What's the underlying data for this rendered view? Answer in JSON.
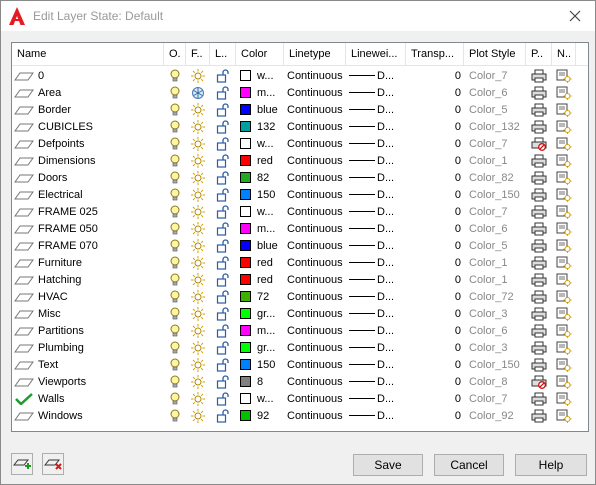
{
  "title": "Edit Layer State: Default",
  "columns": {
    "name": "Name",
    "on": "O.",
    "freeze": "F..",
    "lock": "L..",
    "color": "Color",
    "linetype": "Linetype",
    "lineweight": "Linewei...",
    "transparency": "Transp...",
    "plot_style": "Plot Style",
    "plot": "P..",
    "new_vp_freeze": "N.."
  },
  "layers": [
    {
      "name": "0",
      "color_name": "w...",
      "color": "#ffffff",
      "linetype": "Continuous",
      "lineweight": "D...",
      "transparency": "0",
      "plot_style": "Color_7",
      "icon": "layer-icon",
      "frozen": false,
      "plot": true
    },
    {
      "name": "Area",
      "color_name": "m...",
      "color": "#ff00ff",
      "linetype": "Continuous",
      "lineweight": "D...",
      "transparency": "0",
      "plot_style": "Color_6",
      "icon": "layer-icon",
      "frozen": true,
      "plot": true
    },
    {
      "name": "Border",
      "color_name": "blue",
      "color": "#0000ff",
      "linetype": "Continuous",
      "lineweight": "D...",
      "transparency": "0",
      "plot_style": "Color_5",
      "icon": "layer-icon",
      "frozen": false,
      "plot": true
    },
    {
      "name": "CUBICLES",
      "color_name": "132",
      "color": "#009e9e",
      "linetype": "Continuous",
      "lineweight": "D...",
      "transparency": "0",
      "plot_style": "Color_132",
      "icon": "layer-icon",
      "frozen": false,
      "plot": true
    },
    {
      "name": "Defpoints",
      "color_name": "w...",
      "color": "#ffffff",
      "linetype": "Continuous",
      "lineweight": "D...",
      "transparency": "0",
      "plot_style": "Color_7",
      "icon": "layer-icon",
      "frozen": false,
      "plot": false
    },
    {
      "name": "Dimensions",
      "color_name": "red",
      "color": "#ff0000",
      "linetype": "Continuous",
      "lineweight": "D...",
      "transparency": "0",
      "plot_style": "Color_1",
      "icon": "layer-icon",
      "frozen": false,
      "plot": true
    },
    {
      "name": "Doors",
      "color_name": "82",
      "color": "#22aa22",
      "linetype": "Continuous",
      "lineweight": "D...",
      "transparency": "0",
      "plot_style": "Color_82",
      "icon": "layer-icon",
      "frozen": false,
      "plot": true
    },
    {
      "name": "Electrical",
      "color_name": "150",
      "color": "#0080ff",
      "linetype": "Continuous",
      "lineweight": "D...",
      "transparency": "0",
      "plot_style": "Color_150",
      "icon": "layer-icon",
      "frozen": false,
      "plot": true
    },
    {
      "name": "FRAME 025",
      "color_name": "w...",
      "color": "#ffffff",
      "linetype": "Continuous",
      "lineweight": "D...",
      "transparency": "0",
      "plot_style": "Color_7",
      "icon": "layer-icon",
      "frozen": false,
      "plot": true
    },
    {
      "name": "FRAME 050",
      "color_name": "m...",
      "color": "#ff00ff",
      "linetype": "Continuous",
      "lineweight": "D...",
      "transparency": "0",
      "plot_style": "Color_6",
      "icon": "layer-icon",
      "frozen": false,
      "plot": true
    },
    {
      "name": "FRAME 070",
      "color_name": "blue",
      "color": "#0000ff",
      "linetype": "Continuous",
      "lineweight": "D...",
      "transparency": "0",
      "plot_style": "Color_5",
      "icon": "layer-icon",
      "frozen": false,
      "plot": true
    },
    {
      "name": "Furniture",
      "color_name": "red",
      "color": "#ff0000",
      "linetype": "Continuous",
      "lineweight": "D...",
      "transparency": "0",
      "plot_style": "Color_1",
      "icon": "layer-icon",
      "frozen": false,
      "plot": true
    },
    {
      "name": "Hatching",
      "color_name": "red",
      "color": "#ff0000",
      "linetype": "Continuous",
      "lineweight": "D...",
      "transparency": "0",
      "plot_style": "Color_1",
      "icon": "layer-icon",
      "frozen": false,
      "plot": true
    },
    {
      "name": "HVAC",
      "color_name": "72",
      "color": "#40b000",
      "linetype": "Continuous",
      "lineweight": "D...",
      "transparency": "0",
      "plot_style": "Color_72",
      "icon": "layer-icon",
      "frozen": false,
      "plot": true
    },
    {
      "name": "Misc",
      "color_name": "gr...",
      "color": "#00ff00",
      "linetype": "Continuous",
      "lineweight": "D...",
      "transparency": "0",
      "plot_style": "Color_3",
      "icon": "layer-icon",
      "frozen": false,
      "plot": true
    },
    {
      "name": "Partitions",
      "color_name": "m...",
      "color": "#ff00ff",
      "linetype": "Continuous",
      "lineweight": "D...",
      "transparency": "0",
      "plot_style": "Color_6",
      "icon": "layer-icon",
      "frozen": false,
      "plot": true
    },
    {
      "name": "Plumbing",
      "color_name": "gr...",
      "color": "#00ff00",
      "linetype": "Continuous",
      "lineweight": "D...",
      "transparency": "0",
      "plot_style": "Color_3",
      "icon": "layer-icon",
      "frozen": false,
      "plot": true
    },
    {
      "name": "Text",
      "color_name": "150",
      "color": "#0080ff",
      "linetype": "Continuous",
      "lineweight": "D...",
      "transparency": "0",
      "plot_style": "Color_150",
      "icon": "layer-icon",
      "frozen": false,
      "plot": true
    },
    {
      "name": "Viewports",
      "color_name": "8",
      "color": "#808080",
      "linetype": "Continuous",
      "lineweight": "D...",
      "transparency": "0",
      "plot_style": "Color_8",
      "icon": "layer-icon",
      "frozen": false,
      "plot": false
    },
    {
      "name": "Walls",
      "color_name": "w...",
      "color": "#ffffff",
      "linetype": "Continuous",
      "lineweight": "D...",
      "transparency": "0",
      "plot_style": "Color_7",
      "icon": "current-layer-check-icon",
      "frozen": false,
      "plot": true
    },
    {
      "name": "Windows",
      "color_name": "92",
      "color": "#00c000",
      "linetype": "Continuous",
      "lineweight": "D...",
      "transparency": "0",
      "plot_style": "Color_92",
      "icon": "layer-icon",
      "frozen": false,
      "plot": true
    }
  ],
  "buttons": {
    "save": "Save",
    "cancel": "Cancel",
    "help": "Help"
  },
  "bottom_icons": [
    "add-layers-icon",
    "remove-layers-icon"
  ]
}
